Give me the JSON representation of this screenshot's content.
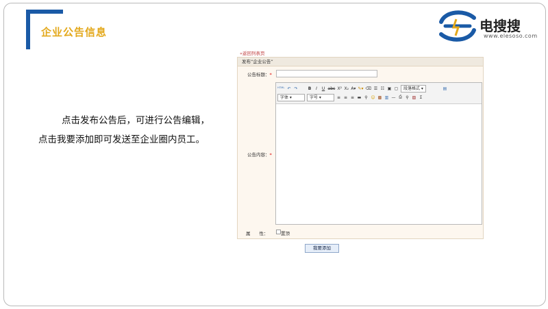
{
  "slide": {
    "title": "企业公告信息",
    "description": "点击发布公告后，可进行公告编辑，点击我要添加即可发送至企业圈内员工。"
  },
  "logo": {
    "name": "电搜搜",
    "url": "www.elesoso.com"
  },
  "colors": {
    "accent_blue": "#1a5aa6",
    "title_gold": "#e3a81b"
  },
  "form": {
    "back_link": "«返回列表页",
    "header": "发布“企业公告”",
    "title_label": "公告标题：",
    "content_label": "公告内容：",
    "required_mark": "*",
    "attr_label": "属　　性：",
    "pin_label": "置顶",
    "submit_label": "我要添加"
  },
  "editor_toolbar": {
    "font_family": "字体",
    "font_size": "字号",
    "paragraph_format": "段落格式",
    "buttons": [
      "html",
      "undo",
      "redo",
      "B",
      "I",
      "U",
      "abc",
      "X²",
      "X₂",
      "A",
      "highlight",
      "clear-format",
      "ordered-list",
      "unordered-list",
      "image",
      "source",
      "align-left",
      "align-center",
      "align-right",
      "hr",
      "link",
      "emoticon",
      "media",
      "table",
      "minus",
      "print",
      "search",
      "select-all",
      "Σ"
    ]
  }
}
